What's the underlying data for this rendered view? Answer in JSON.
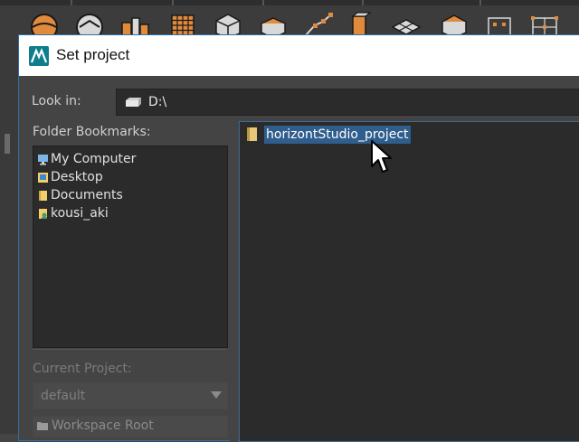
{
  "dialog": {
    "title": "Set project",
    "look_in": {
      "label": "Look in:",
      "value": "D:\\"
    },
    "bookmarks": {
      "label": "Folder Bookmarks:",
      "items": [
        {
          "label": "My Computer",
          "icon": "computer-icon"
        },
        {
          "label": "Desktop",
          "icon": "desktop-icon"
        },
        {
          "label": "Documents",
          "icon": "folder-icon"
        },
        {
          "label": "kousi_aki",
          "icon": "user-folder-icon"
        }
      ]
    },
    "current_project": {
      "label": "Current Project:",
      "value": "default"
    },
    "workspace_root": {
      "label": "Workspace Root"
    },
    "files": [
      {
        "name": "horizontStudio_project",
        "icon": "folder-icon",
        "selected": true
      }
    ]
  },
  "colors": {
    "selection": "#2f5d8c",
    "panel_bg": "#2b2b2b",
    "dialog_bg": "#444444",
    "folder": "#e8c979",
    "accent_orange": "#e08a3c"
  }
}
